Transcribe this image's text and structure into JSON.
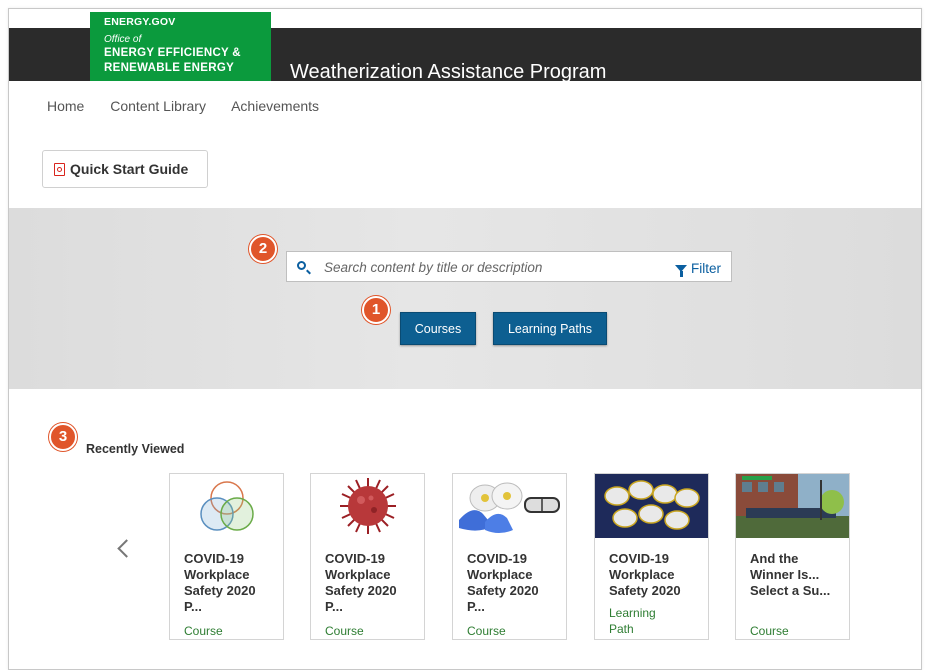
{
  "header": {
    "logo_line1": "ENERGY.GOV",
    "logo_line2": "Office of",
    "logo_line3": "ENERGY EFFICIENCY &",
    "logo_line4": "RENEWABLE ENERGY",
    "title": "Weatherization Assistance Program"
  },
  "nav": {
    "items": [
      "Home",
      "Content Library",
      "Achievements"
    ]
  },
  "quick_start": {
    "label": "Quick Start Guide",
    "icon": "pdf-icon"
  },
  "search": {
    "placeholder": "Search content by title or description",
    "filter_label": "Filter",
    "icon": "search-icon"
  },
  "tabs": {
    "courses": "Courses",
    "learning_paths": "Learning Paths"
  },
  "badges": {
    "b1": "1",
    "b2": "2",
    "b3": "3"
  },
  "recently_viewed": {
    "label": "Recently Viewed",
    "cards": [
      {
        "title": "COVID-19 Workplace Safety 2020 P...",
        "type": "Course",
        "thumb": "venn-diagram"
      },
      {
        "title": "COVID-19 Workplace Safety 2020 P...",
        "type": "Course",
        "thumb": "virus"
      },
      {
        "title": "COVID-19 Workplace Safety 2020 P...",
        "type": "Course",
        "thumb": "masks-gloves-goggles"
      },
      {
        "title": "COVID-19 Workplace Safety 2020",
        "type": "Learning Path",
        "thumb": "respirator-masks"
      },
      {
        "title": "And the Winner Is... Select a Su...",
        "type": "Course",
        "thumb": "street-photo"
      }
    ]
  },
  "colors": {
    "brand_green": "#0b9a3d",
    "header_dark": "#2b2b2b",
    "button_blue": "#0d5f91",
    "badge_orange": "#e0552a",
    "link_blue": "#0b5fa0"
  }
}
